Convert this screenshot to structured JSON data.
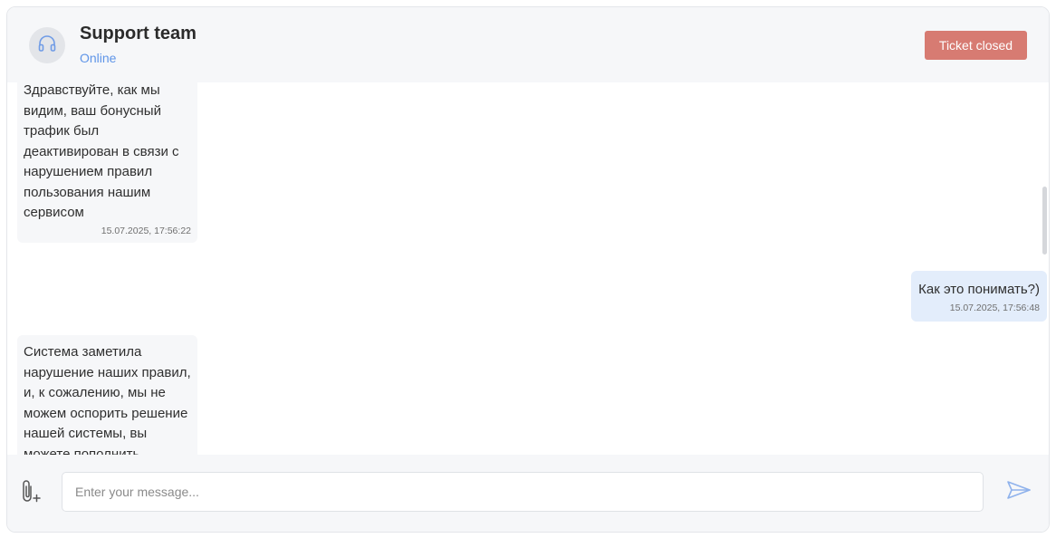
{
  "header": {
    "title": "Support team",
    "status": "Online",
    "ticket_button": "Ticket closed",
    "avatar_icon": "headset-icon"
  },
  "messages": [
    {
      "direction": "incoming",
      "text": "Здравствуйте, как мы видим, ваш бонусный трафик был деактивирован в связи с нарушением правил пользования нашим сервисом",
      "time": "15.07.2025, 17:56:22"
    },
    {
      "direction": "outgoing",
      "text": "Как это понимать?)",
      "time": "15.07.2025, 17:56:48"
    },
    {
      "direction": "incoming",
      "text": "Система заметила нарушение наших правил, и, к сожалению, мы не можем оспорить решение нашей системы, вы можете пополнить",
      "time": ""
    }
  ],
  "composer": {
    "placeholder": "Enter your message...",
    "value": "",
    "attach_icon": "paperclip-icon",
    "send_icon": "send-icon"
  },
  "colors": {
    "accent": "#5f95e8",
    "ticket_closed": "#d77b72",
    "incoming_bubble": "#f6f7f9",
    "outgoing_bubble": "#e3edfb"
  }
}
